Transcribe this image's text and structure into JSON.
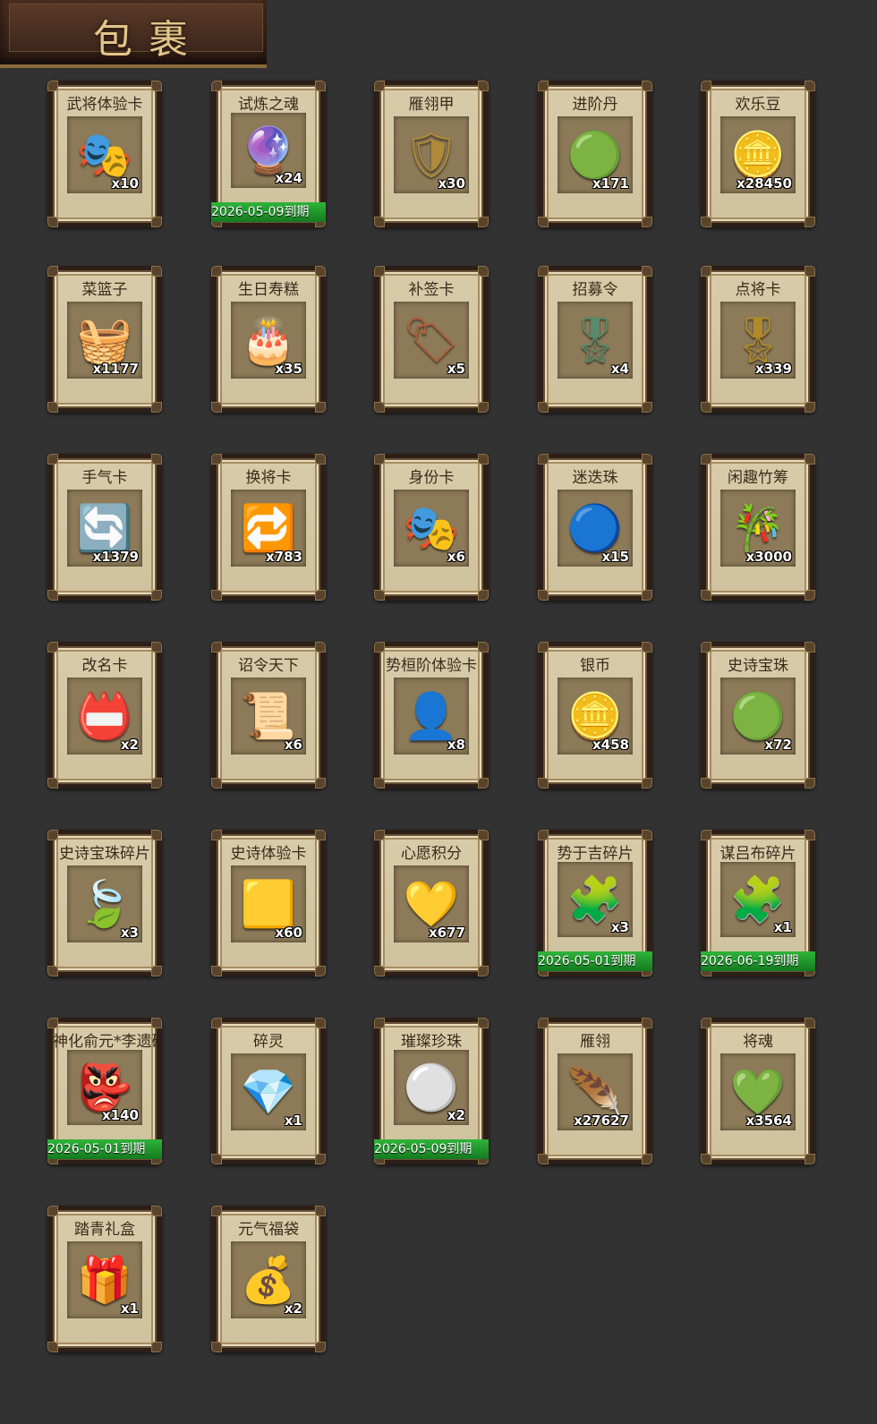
{
  "header": {
    "title": "包裹"
  },
  "items": [
    {
      "name": "武将体验卡",
      "count": "x10",
      "icon": "opera-mask-card-icon",
      "glyph": "🎭",
      "color": "#c0392b"
    },
    {
      "name": "试炼之魂",
      "count": "x24",
      "icon": "blue-soul-orb-icon",
      "glyph": "🔮",
      "color": "#3a4fcf",
      "expiry": "2026-05-09到期"
    },
    {
      "name": "雁翎甲",
      "count": "x30",
      "icon": "armor-icon",
      "glyph": "🛡",
      "color": "#b08a3a"
    },
    {
      "name": "进阶丹",
      "count": "x171",
      "icon": "green-pill-icon",
      "glyph": "🟢",
      "color": "#3fbf3f"
    },
    {
      "name": "欢乐豆",
      "count": "x28450",
      "icon": "gold-beans-icon",
      "glyph": "🪙",
      "color": "#e0b020"
    },
    {
      "name": "菜篮子",
      "count": "x1177",
      "icon": "flower-basket-icon",
      "glyph": "🧺",
      "color": "#b06a2a"
    },
    {
      "name": "生日寿糕",
      "count": "x35",
      "icon": "birthday-cake-icon",
      "glyph": "🎂",
      "color": "#e0a030"
    },
    {
      "name": "补签卡",
      "count": "x5",
      "icon": "sign-tag-icon",
      "glyph": "🏷",
      "color": "#b0603a"
    },
    {
      "name": "招募令",
      "count": "x4",
      "icon": "recruit-token-icon",
      "glyph": "🎖",
      "color": "#5a8a6a"
    },
    {
      "name": "点将卡",
      "count": "x339",
      "icon": "general-card-icon",
      "glyph": "🎖",
      "color": "#b08a2a"
    },
    {
      "name": "手气卡",
      "count": "x1379",
      "icon": "luck-card-icon",
      "glyph": "🔄",
      "color": "#e0a020"
    },
    {
      "name": "换将卡",
      "count": "x783",
      "icon": "swap-general-card-icon",
      "glyph": "🔁",
      "color": "#4a8a5a"
    },
    {
      "name": "身份卡",
      "count": "x6",
      "icon": "identity-mask-card-icon",
      "glyph": "🎭",
      "color": "#c0392b"
    },
    {
      "name": "迷迭珠",
      "count": "x15",
      "icon": "blue-pearl-icon",
      "glyph": "🔵",
      "color": "#3a7ae0"
    },
    {
      "name": "闲趣竹筹",
      "count": "x3000",
      "icon": "bamboo-token-icon",
      "glyph": "🎋",
      "color": "#b08050"
    },
    {
      "name": "改名卡",
      "count": "x2",
      "icon": "rename-card-icon",
      "glyph": "📛",
      "color": "#a04040"
    },
    {
      "name": "诏令天下",
      "count": "x6",
      "icon": "imperial-scroll-icon",
      "glyph": "📜",
      "color": "#c0392b"
    },
    {
      "name": "势桓阶体验卡",
      "count": "x8",
      "icon": "general-portrait-icon",
      "glyph": "👤",
      "color": "#806040"
    },
    {
      "name": "银币",
      "count": "x458",
      "icon": "silver-coins-icon",
      "glyph": "🪙",
      "color": "#9aa0a6"
    },
    {
      "name": "史诗宝珠",
      "count": "x72",
      "icon": "green-orb-icon",
      "glyph": "🟢",
      "color": "#3fbf3f"
    },
    {
      "name": "史诗宝珠碎片",
      "count": "x3",
      "icon": "green-shard-icon",
      "glyph": "🍃",
      "color": "#3fbf3f"
    },
    {
      "name": "史诗体验卡",
      "count": "x60",
      "icon": "gold-card-icon",
      "glyph": "🟨",
      "color": "#e0c040"
    },
    {
      "name": "心愿积分",
      "count": "x677",
      "icon": "heart-coin-icon",
      "glyph": "💛",
      "color": "#c0a060"
    },
    {
      "name": "势于吉碎片",
      "count": "x3",
      "icon": "puzzle-portrait-icon",
      "glyph": "🧩",
      "color": "#c0a060",
      "expiry": "2026-05-01到期"
    },
    {
      "name": "谋吕布碎片",
      "count": "x1",
      "icon": "puzzle-portrait-icon",
      "glyph": "🧩",
      "color": "#c0a060",
      "expiry": "2026-06-19到期"
    },
    {
      "name": "神化俞元*李遗碎片",
      "count": "x140",
      "icon": "warrior-portrait-icon",
      "glyph": "👺",
      "color": "#c0392b",
      "expiry": "2026-05-01到期"
    },
    {
      "name": "碎灵",
      "count": "x1",
      "icon": "crystal-puzzle-icon",
      "glyph": "💎",
      "color": "#6aa0e0"
    },
    {
      "name": "璀璨珍珠",
      "count": "x2",
      "icon": "pearl-icon",
      "glyph": "⚪",
      "color": "#e0e0f0",
      "expiry": "2026-05-09到期"
    },
    {
      "name": "雁翎",
      "count": "x27627",
      "icon": "feather-icon",
      "glyph": "🪶",
      "color": "#d0a050"
    },
    {
      "name": "将魂",
      "count": "x3564",
      "icon": "green-soul-icon",
      "glyph": "💚",
      "color": "#4fcf3f"
    },
    {
      "name": "踏青礼盒",
      "count": "x1",
      "icon": "gift-box-icon",
      "glyph": "🎁",
      "color": "#3f9f4f"
    },
    {
      "name": "元气福袋",
      "count": "x2",
      "icon": "lucky-bag-icon",
      "glyph": "💰",
      "color": "#3f9f4f"
    }
  ]
}
